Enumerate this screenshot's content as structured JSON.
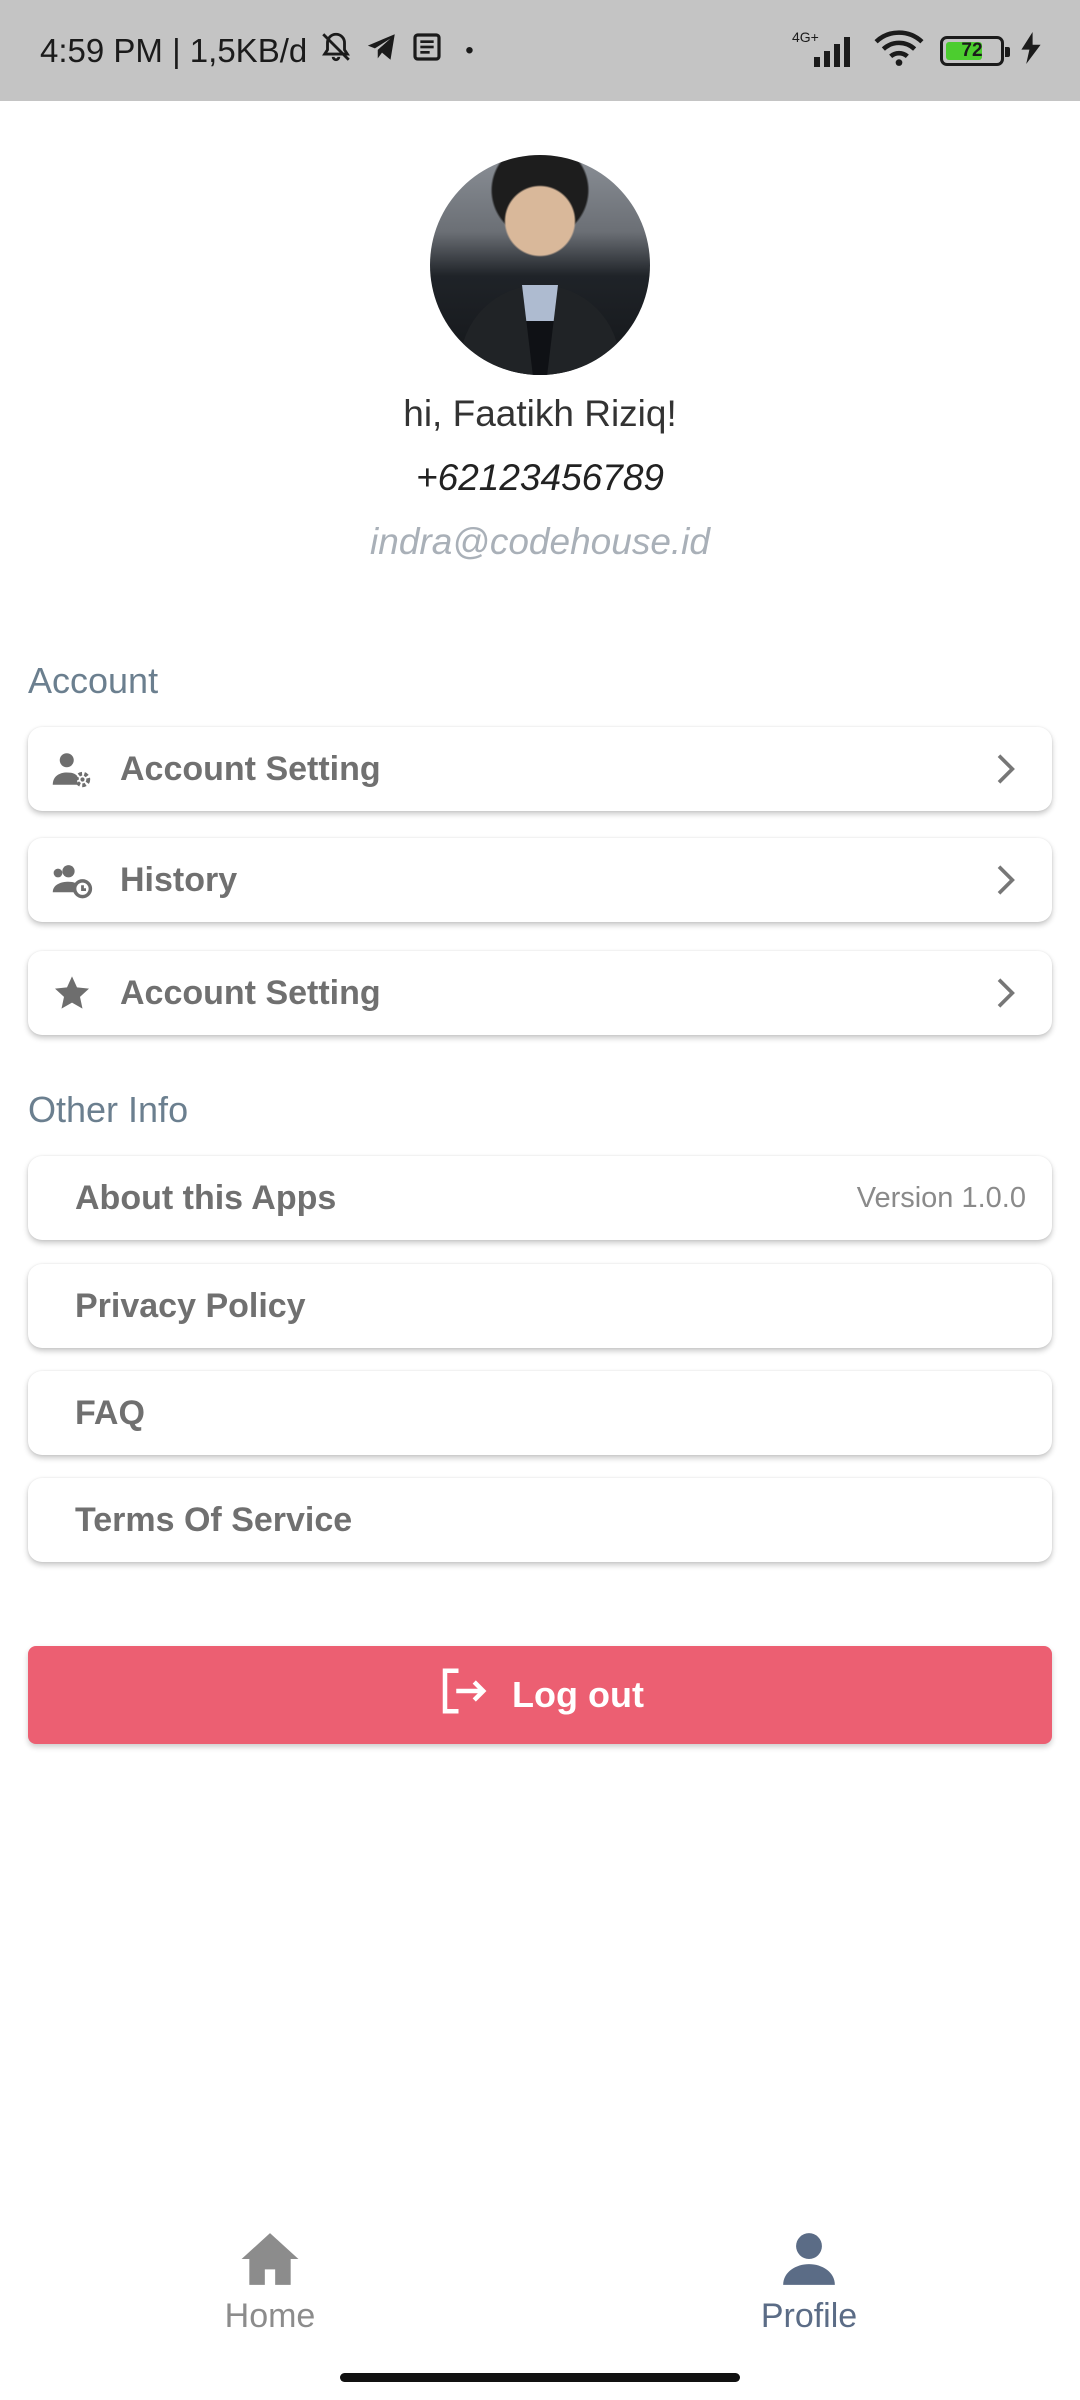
{
  "status_bar": {
    "time_speed": "4:59 PM | 1,5KB/d",
    "dot": "•",
    "network_type": "4G+",
    "battery_level": "72",
    "battery_fraction": 0.72
  },
  "profile": {
    "greeting": "hi, Faatikh Riziq!",
    "phone": "+62123456789",
    "email": "indra@codehouse.id"
  },
  "account_section": {
    "title": "Account",
    "items": [
      {
        "label": "Account Setting",
        "icon": "user-gear-icon"
      },
      {
        "label": "History",
        "icon": "user-clock-icon"
      },
      {
        "label": "Account Setting",
        "icon": "star-icon"
      }
    ]
  },
  "other_section": {
    "title": "Other Info",
    "items": [
      {
        "label": "About this Apps",
        "value": "Version 1.0.0"
      },
      {
        "label": "Privacy Policy"
      },
      {
        "label": "FAQ"
      },
      {
        "label": "Terms Of Service"
      }
    ]
  },
  "logout": {
    "label": "Log out",
    "icon": "logout-icon"
  },
  "bottom_nav": {
    "items": [
      {
        "label": "Home",
        "icon": "home-icon",
        "active": false
      },
      {
        "label": "Profile",
        "icon": "person-icon",
        "active": true
      }
    ]
  },
  "colors": {
    "accent": "#ec5f72",
    "nav_active": "#5b6c86",
    "nav_inactive": "#8c8c8c",
    "section_title": "#6b7f8f"
  }
}
